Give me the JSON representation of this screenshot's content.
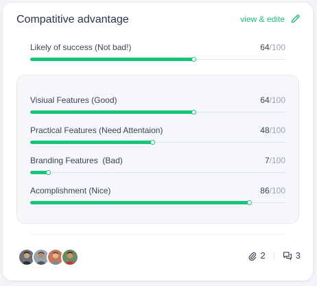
{
  "card": {
    "title": "Compatitive advantage",
    "action_label": "view & edite",
    "action_icon": "pencil-icon"
  },
  "summary_metric": {
    "name": "Likely of success (Not bad!)",
    "value": "64",
    "max": "/100",
    "fraction": 0.64
  },
  "features": [
    {
      "name": "Visiual Features (Good)",
      "value": "64",
      "max": "/100",
      "fraction": 0.64
    },
    {
      "name": "Practical Features (Need Attentaion)",
      "value": "48",
      "max": "/100",
      "fraction": 0.48
    },
    {
      "name": "Branding Features  (Bad)",
      "value": "7",
      "max": "/100",
      "fraction": 0.07
    },
    {
      "name": "Acomplishment (Nice)",
      "value": "86",
      "max": "/100",
      "fraction": 0.86
    }
  ],
  "footer": {
    "avatars": [
      "avatar-1",
      "avatar-2",
      "avatar-3",
      "avatar-4"
    ],
    "attachments_count": "2",
    "comments_count": "3",
    "attachments_icon": "paperclip-icon",
    "comments_icon": "comments-icon"
  },
  "colors": {
    "accent": "#17c47a",
    "track": "#dbe5f0",
    "text": "#3a4253",
    "muted": "#99a3b7"
  }
}
